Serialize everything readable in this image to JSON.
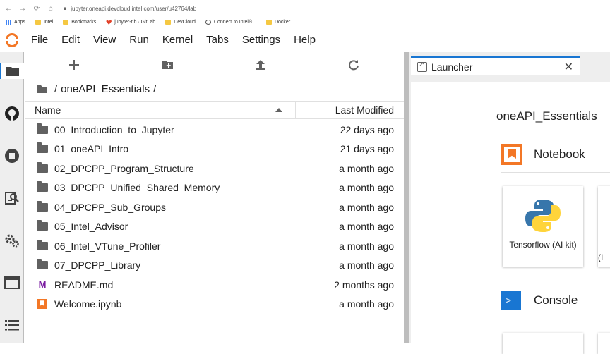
{
  "browser": {
    "url": "jupyter.oneapi.devcloud.intel.com/user/u42764/lab",
    "bookmarks": [
      {
        "label": "Apps",
        "icon": "apps-icon"
      },
      {
        "label": "Intel",
        "icon": "folder-icon"
      },
      {
        "label": "Bookmarks",
        "icon": "folder-icon"
      },
      {
        "label": "jupyter-nb · GitLab",
        "icon": "gitlab-icon"
      },
      {
        "label": "DevCloud",
        "icon": "folder-icon"
      },
      {
        "label": "Connect to Intel®...",
        "icon": "globe-icon"
      },
      {
        "label": "Docker",
        "icon": "folder-icon"
      }
    ]
  },
  "menubar": {
    "items": [
      "File",
      "Edit",
      "View",
      "Run",
      "Kernel",
      "Tabs",
      "Settings",
      "Help"
    ]
  },
  "filebrowser": {
    "breadcrumb": {
      "root": "/",
      "folder": "oneAPI_Essentials",
      "trailing": "/"
    },
    "header": {
      "name": "Name",
      "modified": "Last Modified"
    },
    "files": [
      {
        "name": "00_Introduction_to_Jupyter",
        "modified": "22 days ago",
        "type": "folder"
      },
      {
        "name": "01_oneAPI_Intro",
        "modified": "21 days ago",
        "type": "folder"
      },
      {
        "name": "02_DPCPP_Program_Structure",
        "modified": "a month ago",
        "type": "folder"
      },
      {
        "name": "03_DPCPP_Unified_Shared_Memory",
        "modified": "a month ago",
        "type": "folder"
      },
      {
        "name": "04_DPCPP_Sub_Groups",
        "modified": "a month ago",
        "type": "folder"
      },
      {
        "name": "05_Intel_Advisor",
        "modified": "a month ago",
        "type": "folder"
      },
      {
        "name": "06_Intel_VTune_Profiler",
        "modified": "a month ago",
        "type": "folder"
      },
      {
        "name": "07_DPCPP_Library",
        "modified": "a month ago",
        "type": "folder"
      },
      {
        "name": "README.md",
        "modified": "2 months ago",
        "type": "markdown"
      },
      {
        "name": "Welcome.ipynb",
        "modified": "a month ago",
        "type": "notebook"
      }
    ]
  },
  "launcher": {
    "tab_label": "Launcher",
    "title": "oneAPI_Essentials",
    "notebook_section": "Notebook",
    "console_section": "Console",
    "kernel_card": "Tensorflow (AI kit)",
    "kernel_card_partial": "(I"
  },
  "colors": {
    "accent": "#1976d2",
    "jupyter_orange": "#f37726"
  }
}
